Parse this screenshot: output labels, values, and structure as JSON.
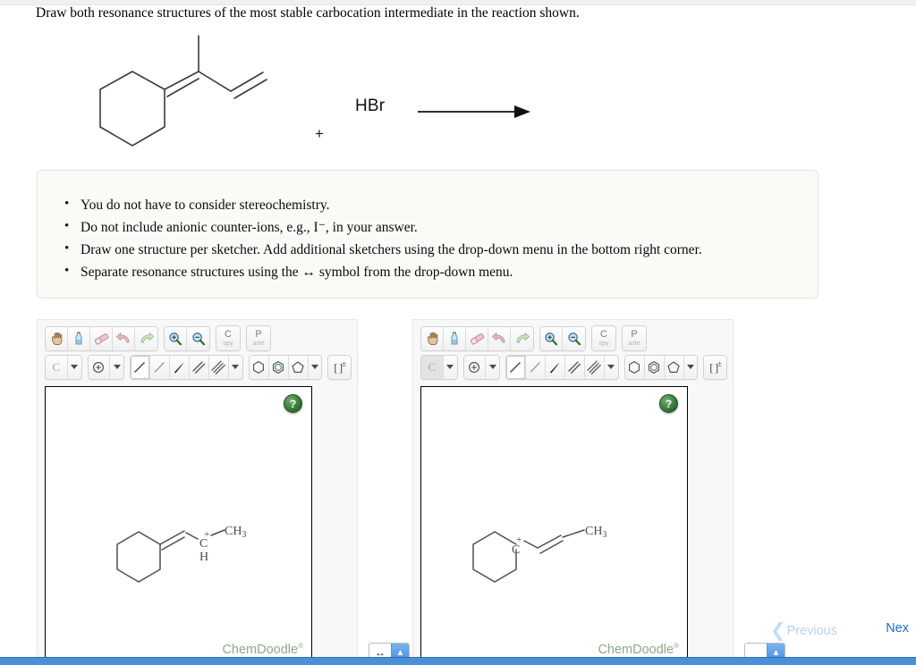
{
  "question": {
    "prompt": "Draw both resonance structures of the most stable carbocation intermediate in the reaction shown."
  },
  "reaction": {
    "plus": "+",
    "reagent": "HBr",
    "arrow_name": "reaction-arrow",
    "reactant_description": "1-methyl-1-cyclohexylidene-butadiene skeletal structure"
  },
  "instructions": {
    "items": [
      "You do not have to consider stereochemistry.",
      "Do not include anionic counter-ions, e.g., I⁻, in your answer.",
      "Draw one structure per sketcher. Add additional sketchers using the drop-down menu in the bottom right corner.",
      "Separate resonance structures using the ↔ symbol from the drop-down menu."
    ]
  },
  "toolbar": {
    "row1": [
      {
        "name": "pan-hand-icon",
        "title": "Pan"
      },
      {
        "name": "lasso-erase-icon",
        "title": "Clear"
      },
      {
        "name": "eraser-icon",
        "title": "Eraser"
      },
      {
        "name": "undo-icon",
        "title": "Undo"
      },
      {
        "name": "redo-icon",
        "title": "Redo"
      },
      {
        "name": "zoom-in-icon",
        "title": "Zoom In"
      },
      {
        "name": "zoom-out-icon",
        "title": "Zoom Out"
      }
    ],
    "copy_big": "C",
    "copy_small": "opy",
    "paste_big": "P",
    "paste_small": "aste",
    "element_label": "C",
    "charge_glyph": "⊕",
    "bracket_label": "[ ]",
    "bracket_sup": "±",
    "row2": [
      {
        "name": "single-bond-icon",
        "title": "Single bond"
      },
      {
        "name": "hash-wedge-bond-icon",
        "title": "Hashed bond"
      },
      {
        "name": "wedge-bond-icon",
        "title": "Wedge bond"
      },
      {
        "name": "double-bond-icon",
        "title": "Double bond"
      },
      {
        "name": "triple-bond-icon",
        "title": "Triple bond"
      },
      {
        "name": "benzene-ring-icon",
        "title": "Benzene"
      },
      {
        "name": "aromatic-ring-icon",
        "title": "Aromatic ring"
      },
      {
        "name": "cyclopentane-ring-icon",
        "title": "Cyclopentane"
      }
    ]
  },
  "sketchers": [
    {
      "id": "sketcher-1",
      "help_label": "?",
      "watermark": "ChemDoodle",
      "watermark_sup": "®",
      "structure": {
        "description": "cyclohexylidene-CH=CH-C(+)(H)-CH3 resonance structure",
        "labels": [
          "C",
          "+",
          "H",
          "CH",
          "3"
        ]
      },
      "selector": {
        "value": "↔",
        "arrow": "▲"
      }
    },
    {
      "id": "sketcher-2",
      "help_label": "?",
      "watermark": "ChemDoodle",
      "watermark_sup": "®",
      "structure": {
        "description": "cyclohexyl-C(+) ring carbon with CH=CH-CH3 chain resonance structure",
        "labels": [
          "C",
          "+",
          "CH",
          "3"
        ]
      },
      "selector": {
        "value": "",
        "arrow": "▲"
      }
    }
  ],
  "navigation": {
    "previous_label": "Previous",
    "previous_chevron": "❮",
    "next_label": "Nex",
    "previous_enabled": false,
    "next_enabled": true
  },
  "colors": {
    "accent_blue": "#1a6fc4",
    "disabled_blue": "#b9d4ee",
    "chemdoodle_green": "#8fa887",
    "help_green": "#2e6b2e",
    "instruction_bg": "#fafaf7"
  }
}
